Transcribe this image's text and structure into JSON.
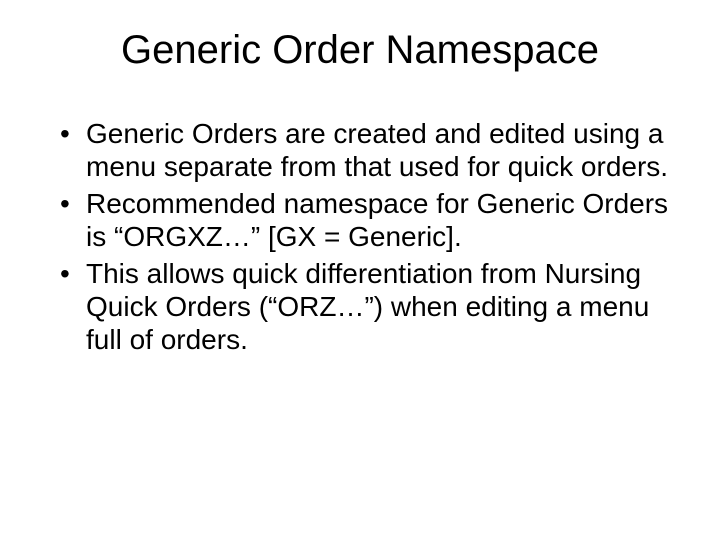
{
  "title": "Generic Order Namespace",
  "bullets": [
    "Generic Orders are created and edited using a menu separate from that used for quick orders.",
    "Recommended namespace for Generic Orders is “ORGXZ…” [GX = Generic].",
    "This allows quick differentiation from Nursing Quick Orders (“ORZ…”) when editing a menu full of orders."
  ]
}
